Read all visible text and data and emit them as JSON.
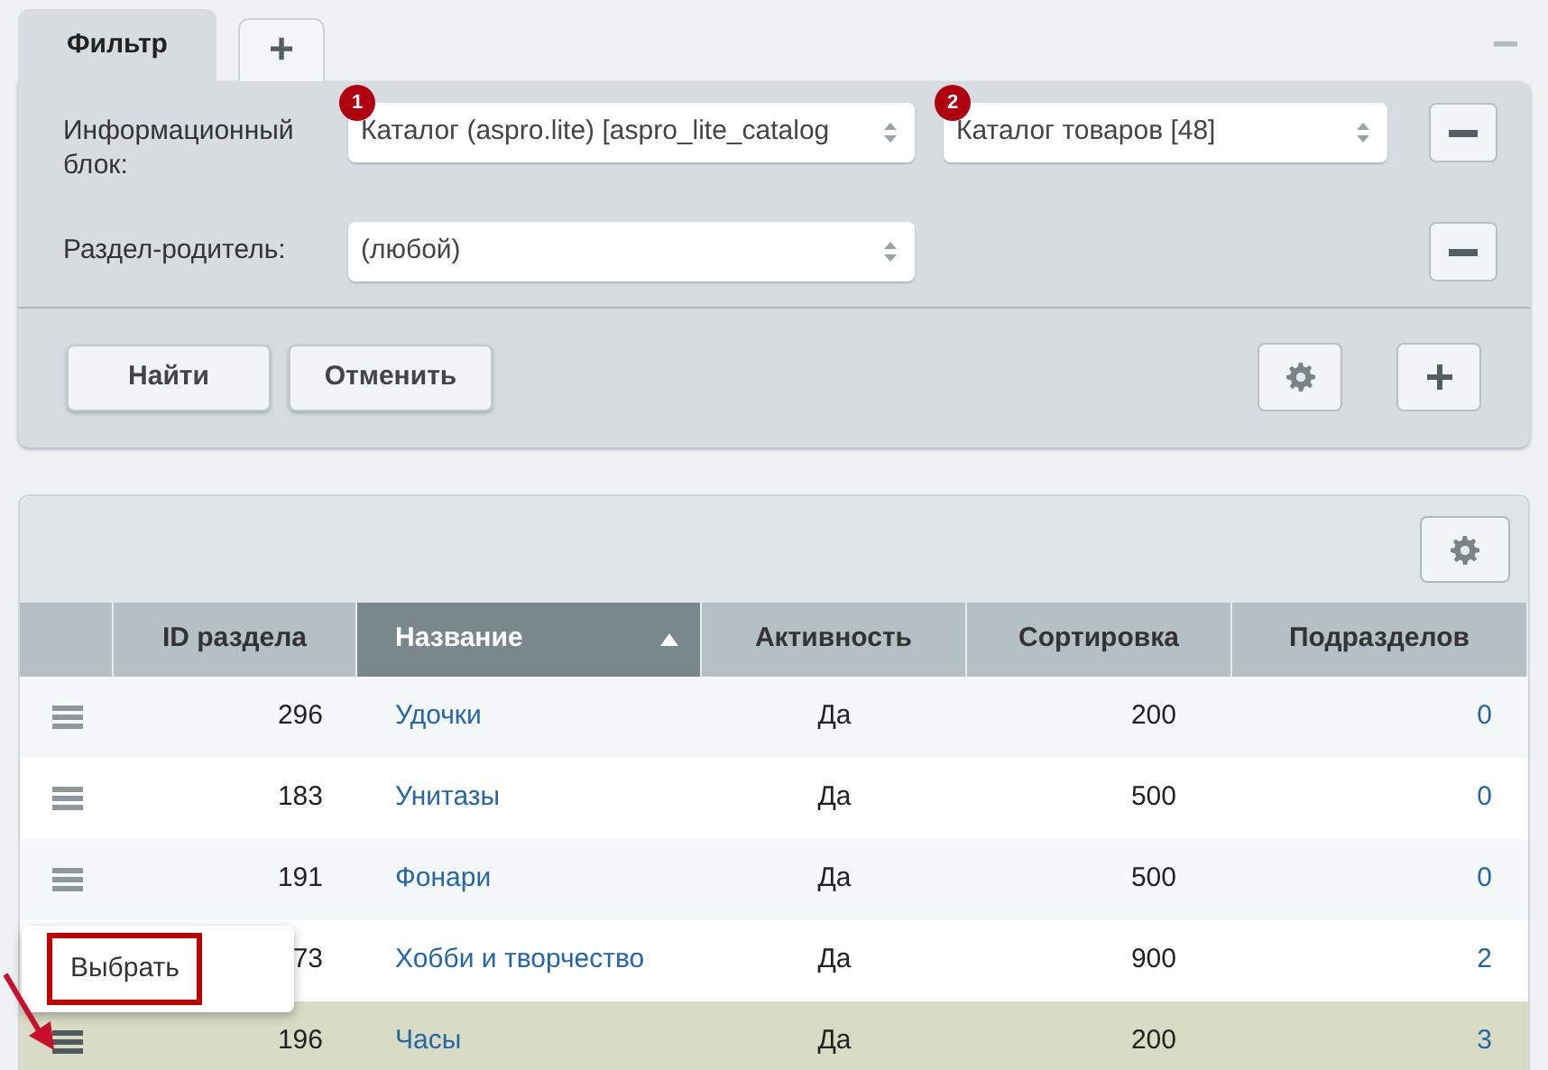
{
  "filter": {
    "tabs": [
      {
        "label": "Фильтр",
        "selected": true,
        "kind": "text"
      },
      {
        "label": "+",
        "selected": false,
        "kind": "add"
      }
    ],
    "collapse": "−",
    "fields": [
      {
        "label": "Информационный блок:",
        "selects": [
          {
            "value": "Каталог (aspro.lite) [aspro_lite_catalog",
            "badge": "1"
          },
          {
            "value": "Каталог товаров [48]",
            "badge": "2"
          }
        ]
      },
      {
        "label": "Раздел-родитель:",
        "selects": [
          {
            "value": "(любой)"
          }
        ]
      }
    ],
    "buttons": [
      "Найти",
      "Отменить"
    ]
  },
  "table": {
    "columns": [
      {
        "sorted": false
      },
      {
        "label": "ID раздела",
        "sorted": false
      },
      {
        "label": "Название",
        "sorted": true
      },
      {
        "label": "Активность",
        "sorted": false
      },
      {
        "label": "Сортировка",
        "sorted": false
      },
      {
        "label": "Подразделов",
        "sorted": false
      }
    ],
    "rows": [
      {
        "id": "296",
        "name": "Удочки",
        "active": "Да",
        "sort": "200",
        "subsections": "0",
        "selected": false
      },
      {
        "id": "183",
        "name": "Унитазы",
        "active": "Да",
        "sort": "500",
        "subsections": "0",
        "selected": false
      },
      {
        "id": "191",
        "name": "Фонари",
        "active": "Да",
        "sort": "500",
        "subsections": "0",
        "selected": false
      },
      {
        "id": "73",
        "handle_hidden": true,
        "name": "Хобби и творчество",
        "active": "Да",
        "sort": "900",
        "subsections": "2",
        "selected": false
      },
      {
        "id": "196",
        "name": "Часы",
        "active": "Да",
        "sort": "200",
        "subsections": "3",
        "selected": true
      }
    ]
  },
  "context_menu": {
    "items": [
      {
        "label": "Выбрать",
        "highlighted": true
      }
    ]
  }
}
